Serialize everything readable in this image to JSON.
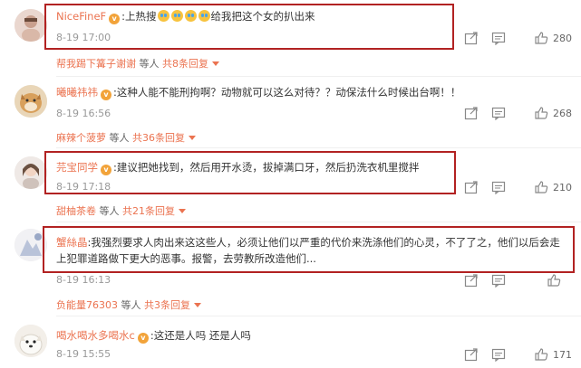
{
  "comments": [
    {
      "username": "NiceFineF",
      "badge": "v",
      "colon": ":",
      "text_before": "上热搜",
      "emoji_count": 4,
      "text_after": "给我把这个女的扒出来",
      "time": "8-19 17:00",
      "likes": "280",
      "reply_user": "帮我踢下篝子谢谢",
      "reply_mid": "等人",
      "reply_count": "共8条回复"
    },
    {
      "username": "曦曦祎祎",
      "badge": "v",
      "colon": ":",
      "text": "这种人能不能刑拘啊？动物就可以这么对待？？动保法什么时候出台啊！！",
      "time": "8-19 16:56",
      "likes": "268",
      "reply_user": "麻辣个菠萝",
      "reply_mid": "等人",
      "reply_count": "共36条回复"
    },
    {
      "username": "芫宝同学",
      "badge": "v",
      "colon": ":",
      "text": "建议把她找到，然后用开水烫，拔掉满口牙，然后扔洗衣机里搅拌",
      "time": "8-19 17:18",
      "likes": "210",
      "reply_user": "甜柚茶卷",
      "reply_mid": "等人",
      "reply_count": "共21条回复"
    },
    {
      "username": "蟹絲晶",
      "colon": ":",
      "text": "我强烈要求人肉出来这这些人，必须让他们以严重的代价来洗涤他们的心灵，不了了之，他们以后会走上犯罪道路做下更大的恶事。报警，去劳教所改造他们...",
      "time": "8-19 16:13",
      "likes": "",
      "reply_user": "负能量76303",
      "reply_mid": "等人",
      "reply_count": "共3条回复"
    },
    {
      "username": "喝水喝水多喝水c",
      "badge": "v",
      "colon": ":",
      "text": "这还是人吗 还是人吗",
      "time": "8-19 15:55",
      "likes": "171"
    }
  ],
  "icons": {
    "share": "share-icon",
    "comment": "comment-icon",
    "like": "thumbs-up-icon",
    "expand": "chevron-down-icon"
  },
  "colors": {
    "username": "#eb7350",
    "highlight": "#b22222",
    "meta": "#999999"
  }
}
